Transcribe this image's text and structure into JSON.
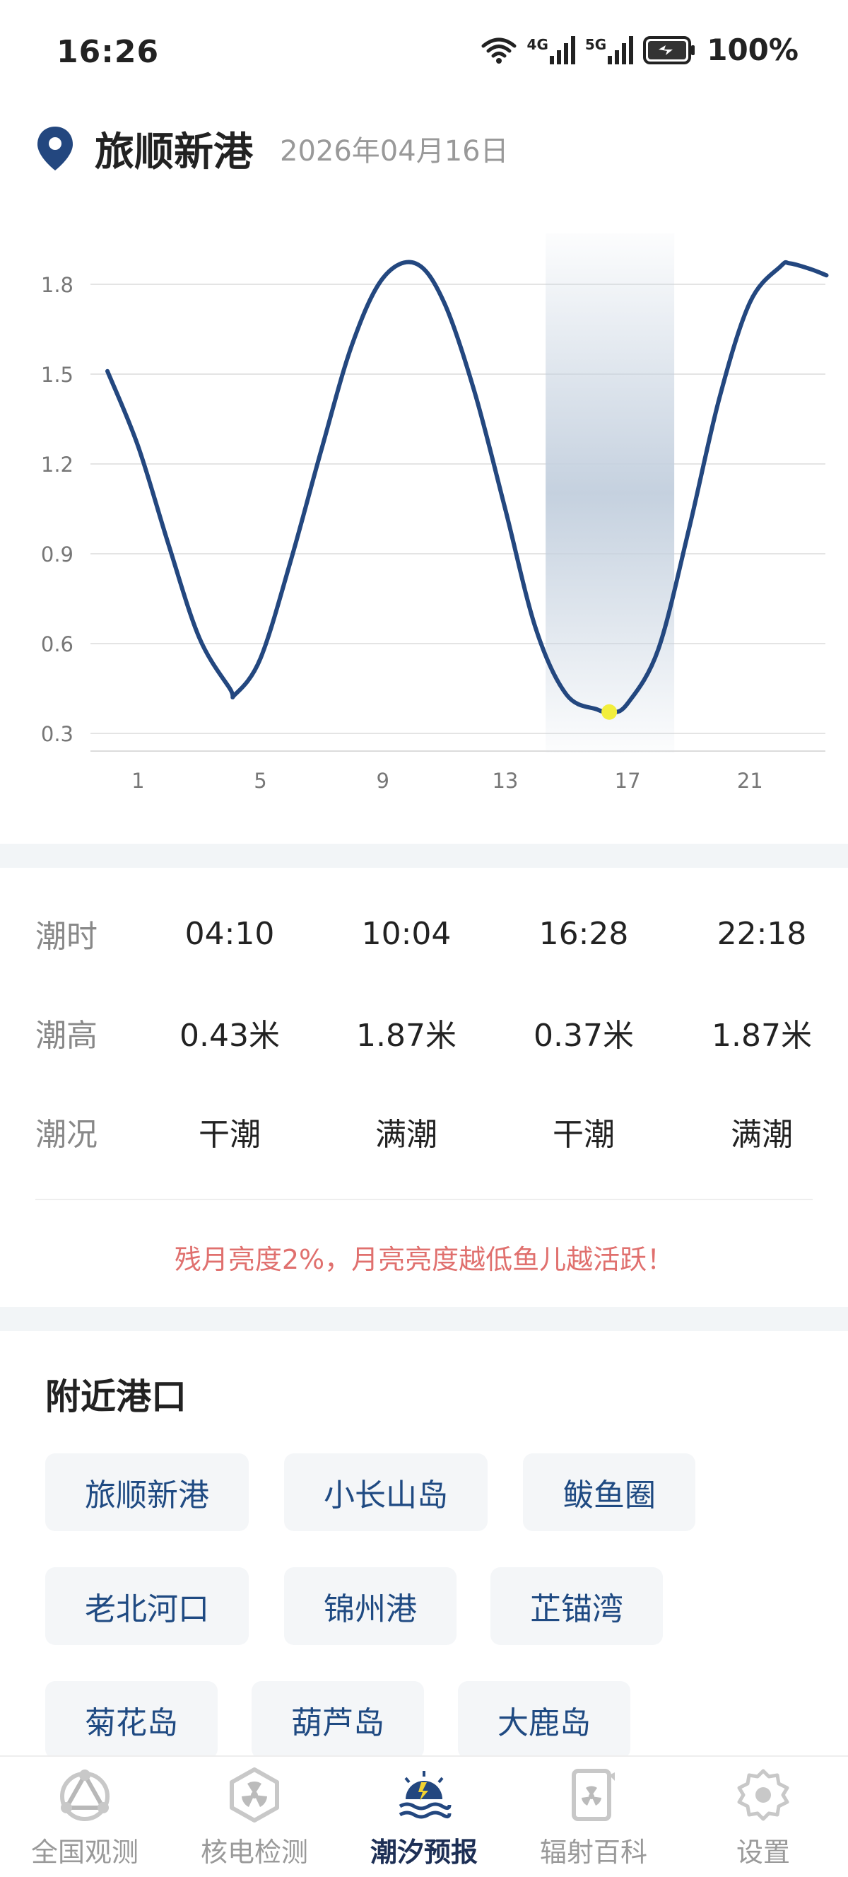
{
  "status_bar": {
    "time": "16:26",
    "net1": "4G",
    "net2": "5G",
    "battery": "100%"
  },
  "header": {
    "port_name": "旅顺新港",
    "date": "2026年04月16日"
  },
  "chart_data": {
    "type": "line",
    "x_ticks": [
      "1",
      "5",
      "9",
      "13",
      "17",
      "21"
    ],
    "y_ticks": [
      "1.8",
      "1.5",
      "1.2",
      "0.9",
      "0.6",
      "0.3"
    ],
    "ylim": [
      0.25,
      1.95
    ],
    "xlim": [
      0,
      24
    ],
    "grid": true,
    "series": [
      {
        "x": [
          0.0,
          1.0,
          2.0,
          3.0,
          4.0,
          4.17,
          5.0,
          6.0,
          7.0,
          8.0,
          9.0,
          10.07,
          11.0,
          12.0,
          13.0,
          14.0,
          15.0,
          16.0,
          16.47,
          17.0,
          18.0,
          19.0,
          20.0,
          21.0,
          22.0,
          22.3,
          23.0,
          23.5
        ],
        "y": [
          1.51,
          1.26,
          0.93,
          0.62,
          0.45,
          0.43,
          0.55,
          0.88,
          1.25,
          1.6,
          1.82,
          1.87,
          1.74,
          1.44,
          1.05,
          0.65,
          0.43,
          0.38,
          0.37,
          0.4,
          0.58,
          0.98,
          1.42,
          1.74,
          1.86,
          1.87,
          1.85,
          1.83
        ]
      }
    ],
    "current_x": 16.4,
    "color": "#23477f",
    "highlight_color": "#c5d1df",
    "dot_color": "#f2ee3c"
  },
  "tide_table": {
    "rows": [
      {
        "label": "潮时",
        "values": [
          "04:10",
          "10:04",
          "16:28",
          "22:18"
        ]
      },
      {
        "label": "潮高",
        "values": [
          "0.43米",
          "1.87米",
          "0.37米",
          "1.87米"
        ]
      },
      {
        "label": "潮况",
        "values": [
          "干潮",
          "满潮",
          "干潮",
          "满潮"
        ]
      }
    ]
  },
  "moon_tip": "残月亮度2%，月亮亮度越低鱼儿越活跃！",
  "nearby": {
    "title": "附近港口",
    "ports": [
      "旅顺新港",
      "小长山岛",
      "鲅鱼圈",
      "老北河口",
      "锦州港",
      "芷锚湾",
      "菊花岛",
      "葫芦岛",
      "大鹿岛"
    ]
  },
  "nav": {
    "items": [
      {
        "label": "全国观测",
        "icon": "network-triangle-icon"
      },
      {
        "label": "核电检测",
        "icon": "radiation-hexagon-icon"
      },
      {
        "label": "潮汐预报",
        "icon": "sunrise-waves-icon"
      },
      {
        "label": "辐射百科",
        "icon": "radiation-book-icon"
      },
      {
        "label": "设置",
        "icon": "gear-icon"
      }
    ],
    "active_index": 2
  }
}
